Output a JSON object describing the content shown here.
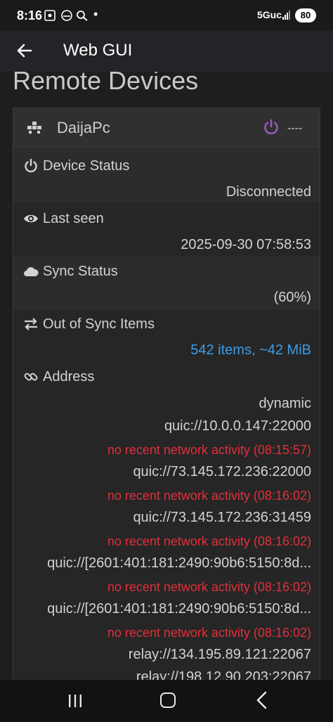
{
  "statusbar": {
    "time": "8:16",
    "icons": [
      "screenshot-icon",
      "gamepad-icon",
      "missed-call-icon"
    ],
    "network": "5Guc",
    "battery": "80"
  },
  "appbar": {
    "title": "Web GUI"
  },
  "page": {
    "heading": "Remote Devices"
  },
  "device": {
    "name": "DaijaPc",
    "status_dashes": "----",
    "accent_color": "#9b59b6",
    "rows": {
      "device_status": {
        "label": "Device Status",
        "value": "Disconnected",
        "icon": "power-icon"
      },
      "last_seen": {
        "label": "Last seen",
        "value": "2025-09-30 07:58:53",
        "icon": "eye-icon"
      },
      "sync_status": {
        "label": "Sync Status",
        "value": "(60%)",
        "icon": "cloud-icon"
      },
      "out_of_sync": {
        "label": "Out of Sync Items",
        "value": "542 items, ~42 MiB",
        "icon": "exchange-icon"
      },
      "address": {
        "label": "Address",
        "icon": "link-icon",
        "lines": [
          {
            "text": "dynamic",
            "kind": "addr"
          },
          {
            "text": "quic://10.0.0.147:22000",
            "kind": "addr"
          },
          {
            "text": "no recent network activity (08:15:57)",
            "kind": "error"
          },
          {
            "text": "quic://73.145.172.236:22000",
            "kind": "addr"
          },
          {
            "text": "no recent network activity (08:16:02)",
            "kind": "error"
          },
          {
            "text": "quic://73.145.172.236:31459",
            "kind": "addr"
          },
          {
            "text": "no recent network activity (08:16:02)",
            "kind": "error"
          },
          {
            "text": "quic://[2601:401:181:2490:90b6:5150:8d...",
            "kind": "addr"
          },
          {
            "text": "no recent network activity (08:16:02)",
            "kind": "error"
          },
          {
            "text": "quic://[2601:401:181:2490:90b6:5150:8d...",
            "kind": "addr"
          },
          {
            "text": "no recent network activity (08:16:02)",
            "kind": "error"
          },
          {
            "text": "relay://134.195.89.121:22067",
            "kind": "addr"
          },
          {
            "text": "relay://198.12.90.203:22067",
            "kind": "addr"
          }
        ]
      }
    }
  },
  "colors": {
    "link_blue": "#3b9ce8",
    "error_red": "#e0303b"
  }
}
